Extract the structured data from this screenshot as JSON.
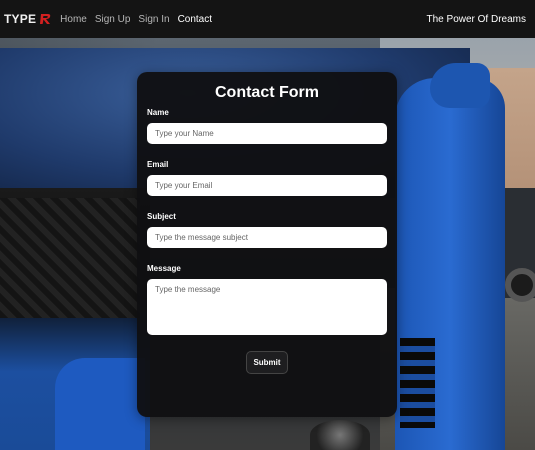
{
  "navbar": {
    "brand": "TYPE",
    "brand_icon": "type-r-logo-icon",
    "brand_icon_color": "#d32020",
    "links": [
      {
        "label": "Home",
        "active": false
      },
      {
        "label": "Sign Up",
        "active": false
      },
      {
        "label": "Sign In",
        "active": false
      },
      {
        "label": "Contact",
        "active": true
      }
    ],
    "tagline": "The Power Of Dreams"
  },
  "form": {
    "title": "Contact Form",
    "name": {
      "label": "Name",
      "placeholder": "Type your Name"
    },
    "email": {
      "label": "Email",
      "placeholder": "Type your Email"
    },
    "subject": {
      "label": "Subject",
      "placeholder": "Type the message subject"
    },
    "message": {
      "label": "Message",
      "placeholder": "Type the message"
    },
    "submit_label": "Submit"
  },
  "colors": {
    "navbar_bg": "#141414",
    "card_bg": "#101012",
    "accent_blue": "#1c56b5"
  }
}
